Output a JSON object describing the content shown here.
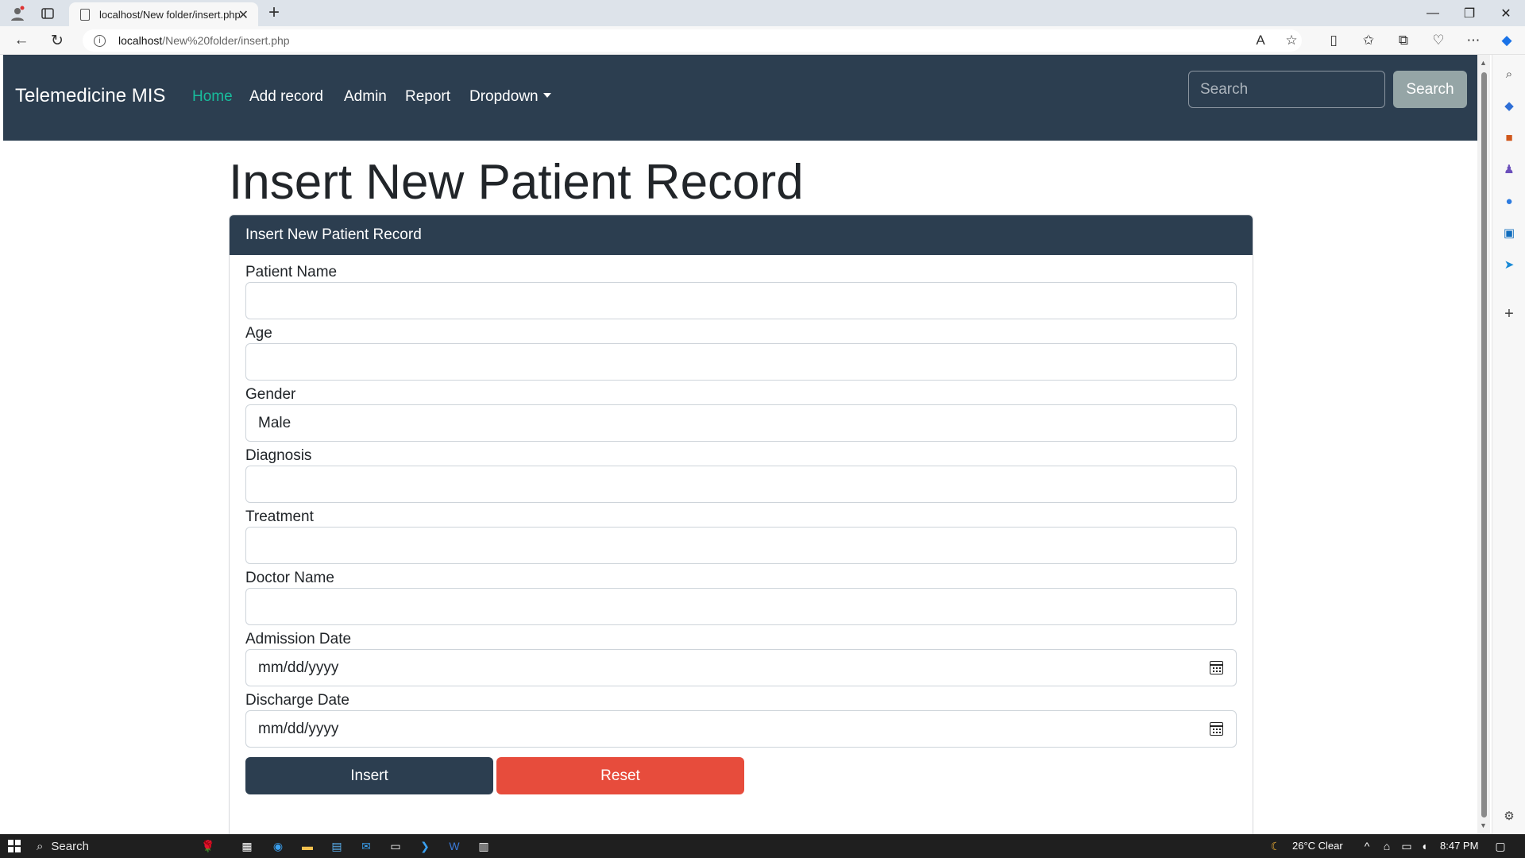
{
  "browser": {
    "tab_title": "localhost/New folder/insert.php",
    "url_host": "localhost",
    "url_path": "/New%20folder/insert.php"
  },
  "navbar": {
    "brand": "Telemedicine MIS",
    "links": [
      "Home",
      "Add record",
      "Admin",
      "Report",
      "Dropdown"
    ],
    "search_placeholder": "Search",
    "search_button": "Search"
  },
  "page": {
    "title": "Insert New Patient Record",
    "card_header": "Insert New Patient Record",
    "fields": {
      "patient_name": {
        "label": "Patient Name",
        "value": ""
      },
      "age": {
        "label": "Age",
        "value": ""
      },
      "gender": {
        "label": "Gender",
        "value": "Male"
      },
      "diagnosis": {
        "label": "Diagnosis",
        "value": ""
      },
      "treatment": {
        "label": "Treatment",
        "value": ""
      },
      "doctor_name": {
        "label": "Doctor Name",
        "value": ""
      },
      "admission_date": {
        "label": "Admission Date",
        "value": "mm/dd/yyyy"
      },
      "discharge_date": {
        "label": "Discharge Date",
        "value": "mm/dd/yyyy"
      }
    },
    "insert_button": "Insert",
    "reset_button": "Reset"
  },
  "taskbar": {
    "search_label": "Search",
    "weather": "26°C  Clear",
    "time": "8:47 PM"
  },
  "colors": {
    "primary": "#2c3e50",
    "success": "#18bc9c",
    "danger": "#e74c3c",
    "secondary": "#95a5a6"
  }
}
